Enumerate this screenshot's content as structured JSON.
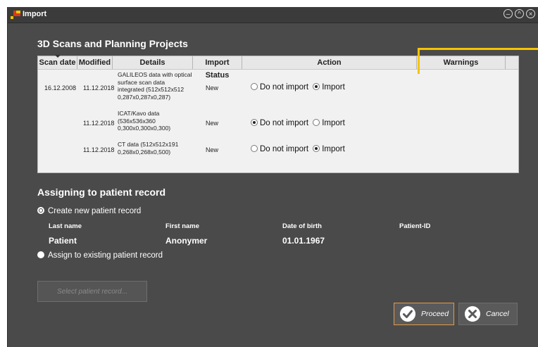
{
  "window": {
    "title": "Import",
    "icons": [
      "app-logo-icon",
      "minimize-icon",
      "maximize-icon",
      "close-icon"
    ]
  },
  "scans": {
    "title": "3D Scans and Planning Projects",
    "columns": [
      "Scan date",
      "Modified",
      "Details",
      "Import Status",
      "Action",
      "Warnings"
    ],
    "rows": [
      {
        "scan_date": "16.12.2008",
        "modified": "11.12.2018",
        "details": [
          "GALILEOS data with optical",
          "surface scan data",
          "integrated (512x512x512",
          "0,287x0,287x0,287)"
        ],
        "status": "New",
        "action_selected": "Import"
      },
      {
        "scan_date": "",
        "modified": "11.12.2018",
        "details": [
          "ICAT/Kavo data",
          "(536x536x360",
          "0,300x0,300x0,300)"
        ],
        "status": "New",
        "action_selected": "Do not import"
      },
      {
        "scan_date": "",
        "modified": "11.12.2018",
        "details": [
          "CT data (512x512x191",
          "0,268x0,268x0,500)"
        ],
        "status": "New",
        "action_selected": "Import"
      }
    ],
    "action_options": [
      "Do not import",
      "Import"
    ]
  },
  "assign": {
    "title": "Assigning to patient record",
    "option_new": "Create new patient record",
    "option_existing": "Assign to existing patient record",
    "selected": "new",
    "fields": [
      {
        "label": "Last name",
        "value": "Patient"
      },
      {
        "label": "First name",
        "value": "Anonymer"
      },
      {
        "label": "Date of birth",
        "value": "01.01.1967"
      },
      {
        "label": "Patient-ID",
        "value": ""
      }
    ],
    "select_button": "Select patient record..."
  },
  "footer": {
    "proceed": "Proceed",
    "cancel": "Cancel"
  },
  "colors": {
    "callout": "#f5c400",
    "proceed_border": "#e59a45"
  }
}
